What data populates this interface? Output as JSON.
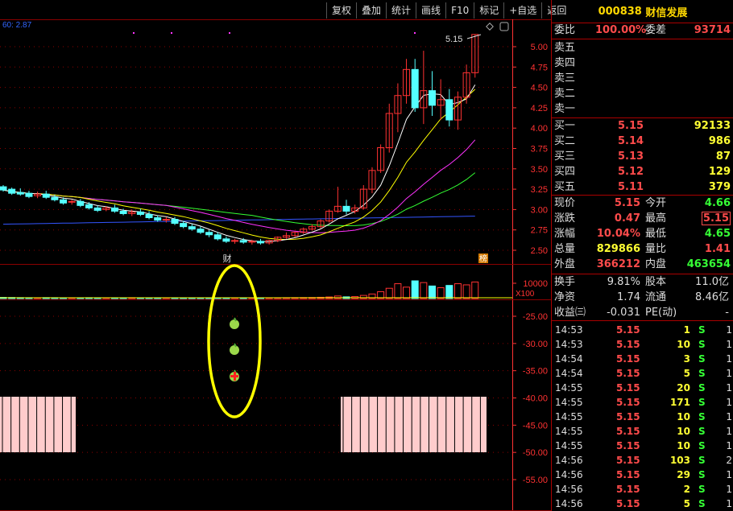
{
  "toolbar": {
    "items": [
      "复权",
      "叠加",
      "统计",
      "画线",
      "F10",
      "标记",
      "+自选",
      "返回"
    ]
  },
  "chart": {
    "ma_label": "60: 2.87",
    "high_label": "5.15",
    "event_marker": "财",
    "rank_marker": "榜",
    "y_axis": [
      "5.00",
      "4.75",
      "4.50",
      "4.25",
      "4.00",
      "3.75",
      "3.50",
      "3.25",
      "3.00",
      "2.75",
      "2.50"
    ],
    "vol_axis": "10000",
    "vol_unit": "X100",
    "ind_axis": [
      "-25.00",
      "-30.00",
      "-35.00",
      "-40.00",
      "-45.00",
      "-50.00",
      "-55.00"
    ],
    "colors": {
      "up": "#ff3232",
      "down": "#54ffff",
      "ma5": "#ffffff",
      "ma10": "#ffff00",
      "ma20": "#ff33ff",
      "ma30": "#33ff33",
      "ma60": "#3355ff",
      "grid": "#8b0000",
      "axis": "#ff3232",
      "highlight": "#ffff00",
      "band": "#ffcccc"
    }
  },
  "quote": {
    "code": "000838",
    "name": "财信发展",
    "weibi_label": "委比",
    "weibi": "100.00%",
    "weicha_label": "委差",
    "weicha": "93714",
    "sells": [
      {
        "label": "卖五"
      },
      {
        "label": "卖四"
      },
      {
        "label": "卖三"
      },
      {
        "label": "卖二"
      },
      {
        "label": "卖一"
      }
    ],
    "buys": [
      {
        "label": "买一",
        "price": "5.15",
        "vol": "92133"
      },
      {
        "label": "买二",
        "price": "5.14",
        "vol": "986"
      },
      {
        "label": "买三",
        "price": "5.13",
        "vol": "87"
      },
      {
        "label": "买四",
        "price": "5.12",
        "vol": "129"
      },
      {
        "label": "买五",
        "price": "5.11",
        "vol": "379"
      }
    ],
    "stats": [
      {
        "l1": "现价",
        "v1": "5.15",
        "c1": "red",
        "l2": "今开",
        "v2": "4.66",
        "c2": "grn"
      },
      {
        "l1": "涨跌",
        "v1": "0.47",
        "c1": "red",
        "l2": "最高",
        "v2": "5.15",
        "c2": "red"
      },
      {
        "l1": "涨幅",
        "v1": "10.04%",
        "c1": "red",
        "l2": "最低",
        "v2": "4.65",
        "c2": "grn"
      },
      {
        "l1": "总量",
        "v1": "829866",
        "c1": "yel",
        "l2": "量比",
        "v2": "1.41",
        "c2": "red"
      },
      {
        "l1": "外盘",
        "v1": "366212",
        "c1": "red",
        "l2": "内盘",
        "v2": "463654",
        "c2": "grn"
      }
    ],
    "stats2": [
      {
        "l1": "换手",
        "v1": "9.81%",
        "l2": "股本",
        "v2": "11.0亿"
      },
      {
        "l1": "净资",
        "v1": "1.74",
        "l2": "流通",
        "v2": "8.46亿"
      },
      {
        "l1": "收益㈢",
        "v1": "-0.031",
        "l2": "PE(动)",
        "v2": "-"
      }
    ]
  },
  "ticks": [
    {
      "t": "14:53",
      "p": "5.15",
      "v": "1",
      "s": "S",
      "n": "1"
    },
    {
      "t": "14:53",
      "p": "5.15",
      "v": "10",
      "s": "S",
      "n": "1"
    },
    {
      "t": "14:54",
      "p": "5.15",
      "v": "3",
      "s": "S",
      "n": "1"
    },
    {
      "t": "14:54",
      "p": "5.15",
      "v": "5",
      "s": "S",
      "n": "1"
    },
    {
      "t": "14:55",
      "p": "5.15",
      "v": "20",
      "s": "S",
      "n": "1"
    },
    {
      "t": "14:55",
      "p": "5.15",
      "v": "171",
      "s": "S",
      "n": "1"
    },
    {
      "t": "14:55",
      "p": "5.15",
      "v": "10",
      "s": "S",
      "n": "1"
    },
    {
      "t": "14:55",
      "p": "5.15",
      "v": "10",
      "s": "S",
      "n": "1"
    },
    {
      "t": "14:55",
      "p": "5.15",
      "v": "10",
      "s": "S",
      "n": "1"
    },
    {
      "t": "14:56",
      "p": "5.15",
      "v": "103",
      "s": "S",
      "n": "2"
    },
    {
      "t": "14:56",
      "p": "5.15",
      "v": "29",
      "s": "S",
      "n": "1"
    },
    {
      "t": "14:56",
      "p": "5.15",
      "v": "2",
      "s": "S",
      "n": "1"
    },
    {
      "t": "14:56",
      "p": "5.15",
      "v": "5",
      "s": "S",
      "n": "1"
    }
  ],
  "candles": [
    [
      3.28,
      3.3,
      3.24,
      3.22
    ],
    [
      3.25,
      3.27,
      3.2,
      3.18
    ],
    [
      3.21,
      3.26,
      3.19,
      3.17
    ],
    [
      3.2,
      3.23,
      3.16,
      3.14
    ],
    [
      3.17,
      3.22,
      3.19,
      3.14
    ],
    [
      3.19,
      3.23,
      3.15,
      3.13
    ],
    [
      3.15,
      3.18,
      3.12,
      3.1
    ],
    [
      3.12,
      3.15,
      3.08,
      3.06
    ],
    [
      3.09,
      3.12,
      3.1,
      3.06
    ],
    [
      3.1,
      3.13,
      3.05,
      3.03
    ],
    [
      3.06,
      3.09,
      3.02,
      3.0
    ],
    [
      3.02,
      3.05,
      2.99,
      2.97
    ],
    [
      3.0,
      3.04,
      3.02,
      2.98
    ],
    [
      3.02,
      3.06,
      2.98,
      2.96
    ],
    [
      2.98,
      3.01,
      2.95,
      2.93
    ],
    [
      2.95,
      3.0,
      2.97,
      2.92
    ],
    [
      2.97,
      3.01,
      2.94,
      2.92
    ],
    [
      2.94,
      2.98,
      2.9,
      2.88
    ],
    [
      2.9,
      2.93,
      2.87,
      2.85
    ],
    [
      2.87,
      2.91,
      2.88,
      2.84
    ],
    [
      2.88,
      2.91,
      2.83,
      2.81
    ],
    [
      2.83,
      2.86,
      2.79,
      2.77
    ],
    [
      2.79,
      2.82,
      2.76,
      2.74
    ],
    [
      2.76,
      2.79,
      2.72,
      2.7
    ],
    [
      2.72,
      2.75,
      2.69,
      2.66
    ],
    [
      2.69,
      2.72,
      2.64,
      2.62
    ],
    [
      2.64,
      2.67,
      2.61,
      2.59
    ],
    [
      2.61,
      2.64,
      2.62,
      2.58
    ],
    [
      2.62,
      2.65,
      2.6,
      2.58
    ],
    [
      2.6,
      2.63,
      2.61,
      2.57
    ],
    [
      2.61,
      2.64,
      2.59,
      2.57
    ],
    [
      2.59,
      2.63,
      2.62,
      2.57
    ],
    [
      2.62,
      2.67,
      2.66,
      2.6
    ],
    [
      2.66,
      2.72,
      2.68,
      2.64
    ],
    [
      2.68,
      2.73,
      2.72,
      2.66
    ],
    [
      2.72,
      2.78,
      2.76,
      2.7
    ],
    [
      2.76,
      2.82,
      2.79,
      2.74
    ],
    [
      2.79,
      2.88,
      2.86,
      2.77
    ],
    [
      2.86,
      3.0,
      2.98,
      2.84
    ],
    [
      2.98,
      3.28,
      3.04,
      2.96
    ],
    [
      3.04,
      3.12,
      2.98,
      2.94
    ],
    [
      2.98,
      3.06,
      3.02,
      2.95
    ],
    [
      3.02,
      3.3,
      3.25,
      3.0
    ],
    [
      3.25,
      3.52,
      3.48,
      3.2
    ],
    [
      3.48,
      3.8,
      3.76,
      3.45
    ],
    [
      3.76,
      4.3,
      4.18,
      3.7
    ],
    [
      4.18,
      4.55,
      4.4,
      3.95
    ],
    [
      4.4,
      4.85,
      4.72,
      4.3
    ],
    [
      4.72,
      4.85,
      4.25,
      4.2
    ],
    [
      4.25,
      4.95,
      4.46,
      4.05
    ],
    [
      4.46,
      4.7,
      4.28,
      4.15
    ],
    [
      4.28,
      4.6,
      4.35,
      4.1
    ],
    [
      4.35,
      4.48,
      4.1,
      4.02
    ],
    [
      4.1,
      4.45,
      4.38,
      3.98
    ],
    [
      4.38,
      4.78,
      4.68,
      4.3
    ],
    [
      4.68,
      5.15,
      5.15,
      4.62
    ]
  ],
  "volumes": [
    20,
    18,
    16,
    15,
    14,
    16,
    15,
    14,
    13,
    14,
    15,
    13,
    12,
    14,
    13,
    15,
    14,
    13,
    12,
    14,
    13,
    12,
    11,
    12,
    11,
    13,
    12,
    11,
    12,
    11,
    12,
    13,
    14,
    15,
    16,
    17,
    18,
    22,
    28,
    45,
    30,
    35,
    55,
    80,
    120,
    180,
    260,
    200,
    310,
    280,
    220,
    190,
    230,
    260,
    240,
    290
  ]
}
